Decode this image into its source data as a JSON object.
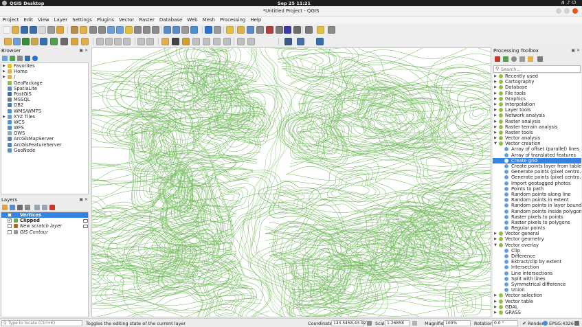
{
  "system_bar": {
    "app_name": "QGIS Desktop",
    "clock": "Sep 25  11:21"
  },
  "window": {
    "title": "*Untitled Project - QGIS"
  },
  "menu": [
    "Project",
    "Edit",
    "View",
    "Layer",
    "Settings",
    "Plugins",
    "Vector",
    "Raster",
    "Database",
    "Web",
    "Mesh",
    "Processing",
    "Help"
  ],
  "browser": {
    "title": "Browser",
    "items": [
      {
        "label": "Favorites",
        "icon": "star-icon",
        "color": "#f3c012",
        "expand": true
      },
      {
        "label": "Home",
        "icon": "folder-icon",
        "color": "#e0b04a",
        "expand": true
      },
      {
        "label": "/",
        "icon": "folder-icon",
        "color": "#e0b04a",
        "expand": true
      },
      {
        "label": "GeoPackage",
        "icon": "geopackage-icon",
        "color": "#8fbe46",
        "expand": false
      },
      {
        "label": "SpatiaLite",
        "icon": "spatialite-icon",
        "color": "#5a8ac8",
        "expand": false
      },
      {
        "label": "PostGIS",
        "icon": "postgis-icon",
        "color": "#3a6ea8",
        "expand": false
      },
      {
        "label": "MSSQL",
        "icon": "mssql-icon",
        "color": "#7a7a7a",
        "expand": false
      },
      {
        "label": "DB2",
        "icon": "db2-icon",
        "color": "#4a7db5",
        "expand": false
      },
      {
        "label": "WMS/WMTS",
        "icon": "globe-icon",
        "color": "#4a8fd0",
        "expand": false
      },
      {
        "label": "XYZ Tiles",
        "icon": "tiles-icon",
        "color": "#6a9fd8",
        "expand": true
      },
      {
        "label": "WCS",
        "icon": "globe-icon",
        "color": "#4a8fd0",
        "expand": false
      },
      {
        "label": "WFS",
        "icon": "globe-icon",
        "color": "#4a8fd0",
        "expand": false
      },
      {
        "label": "OWS",
        "icon": "globe-icon",
        "color": "#9aa4ad",
        "expand": false
      },
      {
        "label": "ArcGisMapServer",
        "icon": "arcgis-icon",
        "color": "#5a7fb5",
        "expand": false
      },
      {
        "label": "ArcGisFeatureServer",
        "icon": "arcgis-icon",
        "color": "#5a7fb5",
        "expand": false
      },
      {
        "label": "GeoNode",
        "icon": "geonode-icon",
        "color": "#4a8fd0",
        "expand": false
      }
    ]
  },
  "layers": {
    "title": "Layers",
    "items": [
      {
        "label": "Vertices",
        "checked": false,
        "selected": true,
        "style": "bold-italic",
        "swatch": "#3584e4"
      },
      {
        "label": "Clipped",
        "checked": true,
        "selected": false,
        "style": "bold",
        "swatch": "#6aaa55"
      },
      {
        "label": "New scratch layer",
        "checked": false,
        "selected": false,
        "style": "italic",
        "swatch": "#b5651d"
      },
      {
        "label": "GIS Contour",
        "checked": false,
        "selected": false,
        "style": "italic",
        "swatch": "#999999"
      }
    ]
  },
  "toolbox": {
    "title": "Processing Toolbox",
    "search_placeholder": "Search...",
    "items": [
      {
        "label": "Recently used",
        "level": 0,
        "expand": "right"
      },
      {
        "label": "Cartography",
        "level": 0,
        "expand": "right"
      },
      {
        "label": "Database",
        "level": 0,
        "expand": "right"
      },
      {
        "label": "File tools",
        "level": 0,
        "expand": "right"
      },
      {
        "label": "Graphics",
        "level": 0,
        "expand": "right"
      },
      {
        "label": "Interpolation",
        "level": 0,
        "expand": "right"
      },
      {
        "label": "Layer tools",
        "level": 0,
        "expand": "right"
      },
      {
        "label": "Network analysis",
        "level": 0,
        "expand": "right"
      },
      {
        "label": "Raster analysis",
        "level": 0,
        "expand": "right"
      },
      {
        "label": "Raster terrain analysis",
        "level": 0,
        "expand": "right"
      },
      {
        "label": "Raster tools",
        "level": 0,
        "expand": "right"
      },
      {
        "label": "Vector analysis",
        "level": 0,
        "expand": "right"
      },
      {
        "label": "Vector creation",
        "level": 0,
        "expand": "down"
      },
      {
        "label": "Array of offset (parallel) lines",
        "level": 1
      },
      {
        "label": "Array of translated features",
        "level": 1
      },
      {
        "label": "Create grid",
        "level": 1,
        "selected": true
      },
      {
        "label": "Create points layer from table",
        "level": 1
      },
      {
        "label": "Generate points (pixel centro...",
        "level": 1
      },
      {
        "label": "Generate points (pixel centro...",
        "level": 1
      },
      {
        "label": "Import geotagged photos",
        "level": 1
      },
      {
        "label": "Points to path",
        "level": 1
      },
      {
        "label": "Random points along line",
        "level": 1
      },
      {
        "label": "Random points in extent",
        "level": 1
      },
      {
        "label": "Random points in layer bounds",
        "level": 1
      },
      {
        "label": "Random points inside polygons",
        "level": 1
      },
      {
        "label": "Raster pixels to points",
        "level": 1
      },
      {
        "label": "Raster pixels to polygons",
        "level": 1
      },
      {
        "label": "Regular points",
        "level": 1
      },
      {
        "label": "Vector general",
        "level": 0,
        "expand": "right"
      },
      {
        "label": "Vector geometry",
        "level": 0,
        "expand": "right"
      },
      {
        "label": "Vector overlay",
        "level": 0,
        "expand": "down"
      },
      {
        "label": "Clip",
        "level": 1
      },
      {
        "label": "Difference",
        "level": 1
      },
      {
        "label": "Extract/clip by extent",
        "level": 1
      },
      {
        "label": "Intersection",
        "level": 1
      },
      {
        "label": "Line intersections",
        "level": 1
      },
      {
        "label": "Split with lines",
        "level": 1
      },
      {
        "label": "Symmetrical difference",
        "level": 1
      },
      {
        "label": "Union",
        "level": 1
      },
      {
        "label": "Vector selection",
        "level": 0,
        "expand": "right"
      },
      {
        "label": "Vector table",
        "level": 0,
        "expand": "right"
      },
      {
        "label": "GDAL",
        "level": 0,
        "expand": "right"
      },
      {
        "label": "GRASS",
        "level": 0,
        "expand": "right"
      }
    ]
  },
  "statusbar": {
    "locate_placeholder": "Type to locate (Ctrl+K)",
    "message": "Toggles the editing state of the current layer",
    "coordinate_label": "Coordinate",
    "coordinate_value": "143.5458,43.9273",
    "scale_label": "Scale",
    "scale_value": "1:26858",
    "magnifier_label": "Magnifier",
    "magnifier_value": "100%",
    "rotation_label": "Rotation",
    "rotation_value": "0.0 °",
    "render_label": "Render",
    "crs": "EPSG:4326"
  },
  "colors": {
    "contour": "#7cbf68",
    "selection": "#3584e4",
    "accent": "#e95420"
  }
}
